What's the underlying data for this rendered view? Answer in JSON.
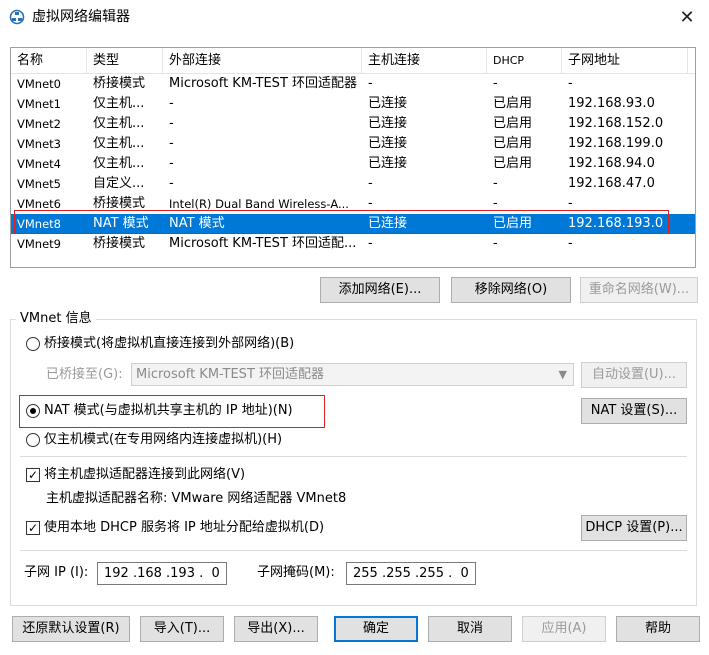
{
  "window": {
    "title": "虚拟网络编辑器",
    "icon": "network-editor-icon",
    "close": "✕"
  },
  "table": {
    "headers": [
      "名称",
      "类型",
      "外部连接",
      "主机连接",
      "DHCP",
      "子网地址"
    ],
    "rows": [
      [
        "VMnet0",
        "桥接模式",
        "Microsoft KM-TEST 环回适配器",
        "-",
        "-",
        "-"
      ],
      [
        "VMnet1",
        "仅主机...",
        "-",
        "已连接",
        "已启用",
        "192.168.93.0"
      ],
      [
        "VMnet2",
        "仅主机...",
        "-",
        "已连接",
        "已启用",
        "192.168.152.0"
      ],
      [
        "VMnet3",
        "仅主机...",
        "-",
        "已连接",
        "已启用",
        "192.168.199.0"
      ],
      [
        "VMnet4",
        "仅主机...",
        "-",
        "已连接",
        "已启用",
        "192.168.94.0"
      ],
      [
        "VMnet5",
        "自定义...",
        "-",
        "-",
        "-",
        "192.168.47.0"
      ],
      [
        "VMnet6",
        "桥接模式",
        "Intel(R) Dual Band Wireless-A...",
        "-",
        "-",
        "-"
      ],
      [
        "VMnet8",
        "NAT 模式",
        "NAT 模式",
        "已连接",
        "已启用",
        "192.168.193.0"
      ],
      [
        "VMnet9",
        "桥接模式",
        "Microsoft KM-TEST 环回适配...",
        "-",
        "-",
        "-"
      ]
    ],
    "selected_index": 7
  },
  "table_buttons": {
    "add": "添加网络(E)...",
    "remove": "移除网络(O)",
    "rename": "重命名网络(W)..."
  },
  "vmnet_info": {
    "title": "VMnet 信息",
    "bridged_label": "桥接模式(将虚拟机直接连接到外部网络)(B)",
    "bridged_to_label": "已桥接至(G):",
    "bridged_to_value": "Microsoft KM-TEST 环回适配器",
    "auto_settings": "自动设置(U)...",
    "nat_label": "NAT 模式(与虚拟机共享主机的 IP 地址)(N)",
    "nat_settings": "NAT 设置(S)...",
    "hostonly_label": "仅主机模式(在专用网络内连接虚拟机)(H)",
    "connect_adapter_label": "将主机虚拟适配器连接到此网络(V)",
    "adapter_name_label": "主机虚拟适配器名称: VMware 网络适配器 VMnet8",
    "dhcp_label": "使用本地 DHCP 服务将 IP 地址分配给虚拟机(D)",
    "dhcp_settings": "DHCP 设置(P)...",
    "subnet_ip_label": "子网 IP (I):",
    "subnet_ip_value": "192 .168 .193 .  0",
    "subnet_mask_label": "子网掩码(M):",
    "subnet_mask_value": "255 .255 .255 .  0",
    "mode": "nat",
    "connect_adapter_checked": true,
    "dhcp_checked": true
  },
  "bottom_buttons": {
    "restore": "还原默认设置(R)",
    "import": "导入(T)...",
    "export": "导出(X)...",
    "ok": "确定",
    "cancel": "取消",
    "apply": "应用(A)",
    "help": "帮助"
  },
  "colors": {
    "selection": "#0078d7",
    "highlight_box": "#e02020"
  }
}
